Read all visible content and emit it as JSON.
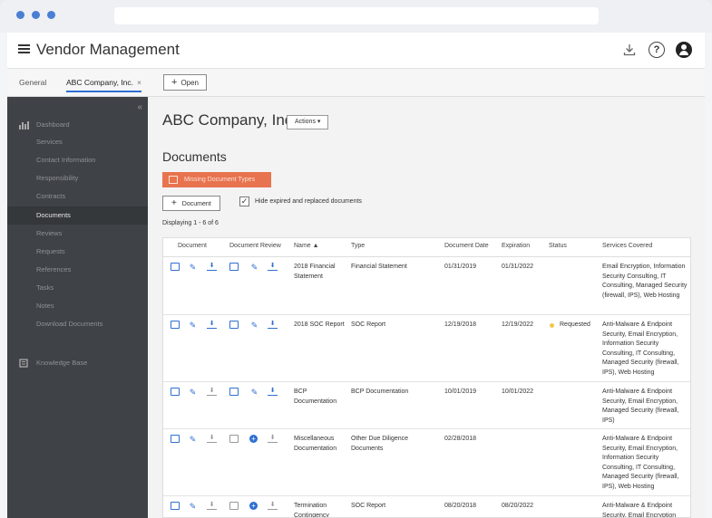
{
  "app": {
    "title": "Vendor Management"
  },
  "tabs": [
    {
      "label": "General"
    },
    {
      "label": "ABC Company, Inc.",
      "close": "×"
    }
  ],
  "open_button": {
    "label": "Open",
    "icon": "+"
  },
  "sidebar": {
    "collapse": "«",
    "items": [
      {
        "label": "Dashboard",
        "icon": "dashboard-icon"
      },
      {
        "label": "Services"
      },
      {
        "label": "Contact Information"
      },
      {
        "label": "Responsibility"
      },
      {
        "label": "Contracts"
      },
      {
        "label": "Documents",
        "active": true
      },
      {
        "label": "Reviews"
      },
      {
        "label": "Requests"
      },
      {
        "label": "References"
      },
      {
        "label": "Tasks"
      },
      {
        "label": "Notes"
      },
      {
        "label": "Download Documents"
      },
      {
        "label": "Knowledge Base",
        "icon": "book-icon"
      }
    ]
  },
  "main": {
    "company": "ABC Company, Inc.",
    "actions_label": "Actions ▾",
    "section_title": "Documents",
    "missing_label": "Missing Document Types",
    "add_document_label": "Document",
    "hide_expired_label": "Hide expired and replaced documents",
    "hide_expired_checked": "✓",
    "displaying": "Displaying 1 - 6 of 6"
  },
  "table": {
    "columns": [
      "Document",
      "Document Review",
      "Name ▲",
      "Type",
      "Document Date",
      "Expiration",
      "Status",
      "Services Covered"
    ],
    "rows": [
      {
        "name": "2018 Financial Statement",
        "type": "Financial Statement",
        "date": "01/31/2019",
        "expiration": "01/31/2022",
        "status": "",
        "services": "Email Encryption, Information Security Consulting, IT Consulting, Managed Security (firewall, IPS), Web Hosting",
        "review_mode": "review"
      },
      {
        "name": "2018 SOC Report",
        "type": "SOC Report",
        "date": "12/19/2018",
        "expiration": "12/19/2022",
        "status": "Requested",
        "services": "Anti-Malware & Endpoint Security, Email Encryption, Information Security Consulting, IT Consulting, Managed Security (firewall, IPS), Web Hosting",
        "review_mode": "review"
      },
      {
        "name": "BCP Documentation",
        "type": "BCP Documentation",
        "date": "10/01/2019",
        "expiration": "10/01/2022",
        "status": "",
        "services": "Anti-Malware & Endpoint Security, Email Encryption, Managed Security (firewall, IPS)",
        "review_mode": "review"
      },
      {
        "name": "Miscellaneous Documentation",
        "type": "Other Due Diligence Documents",
        "date": "02/28/2018",
        "expiration": "",
        "status": "",
        "services": "Anti-Malware & Endpoint Security, Email Encryption, Information Security Consulting, IT Consulting, Managed Security (firewall, IPS), Web Hosting",
        "review_mode": "add"
      },
      {
        "name": "Termination Contingency",
        "type": "SOC Report",
        "date": "08/20/2018",
        "expiration": "08/20/2022",
        "status": "",
        "services": "Anti-Malware & Endpoint Security, Email Encryption",
        "review_mode": "add"
      }
    ]
  },
  "colors": {
    "accent": "#2f6fd1",
    "warning": "#e8734f",
    "sidebar": "#3f4246",
    "status_requested": "#f2c84b"
  }
}
